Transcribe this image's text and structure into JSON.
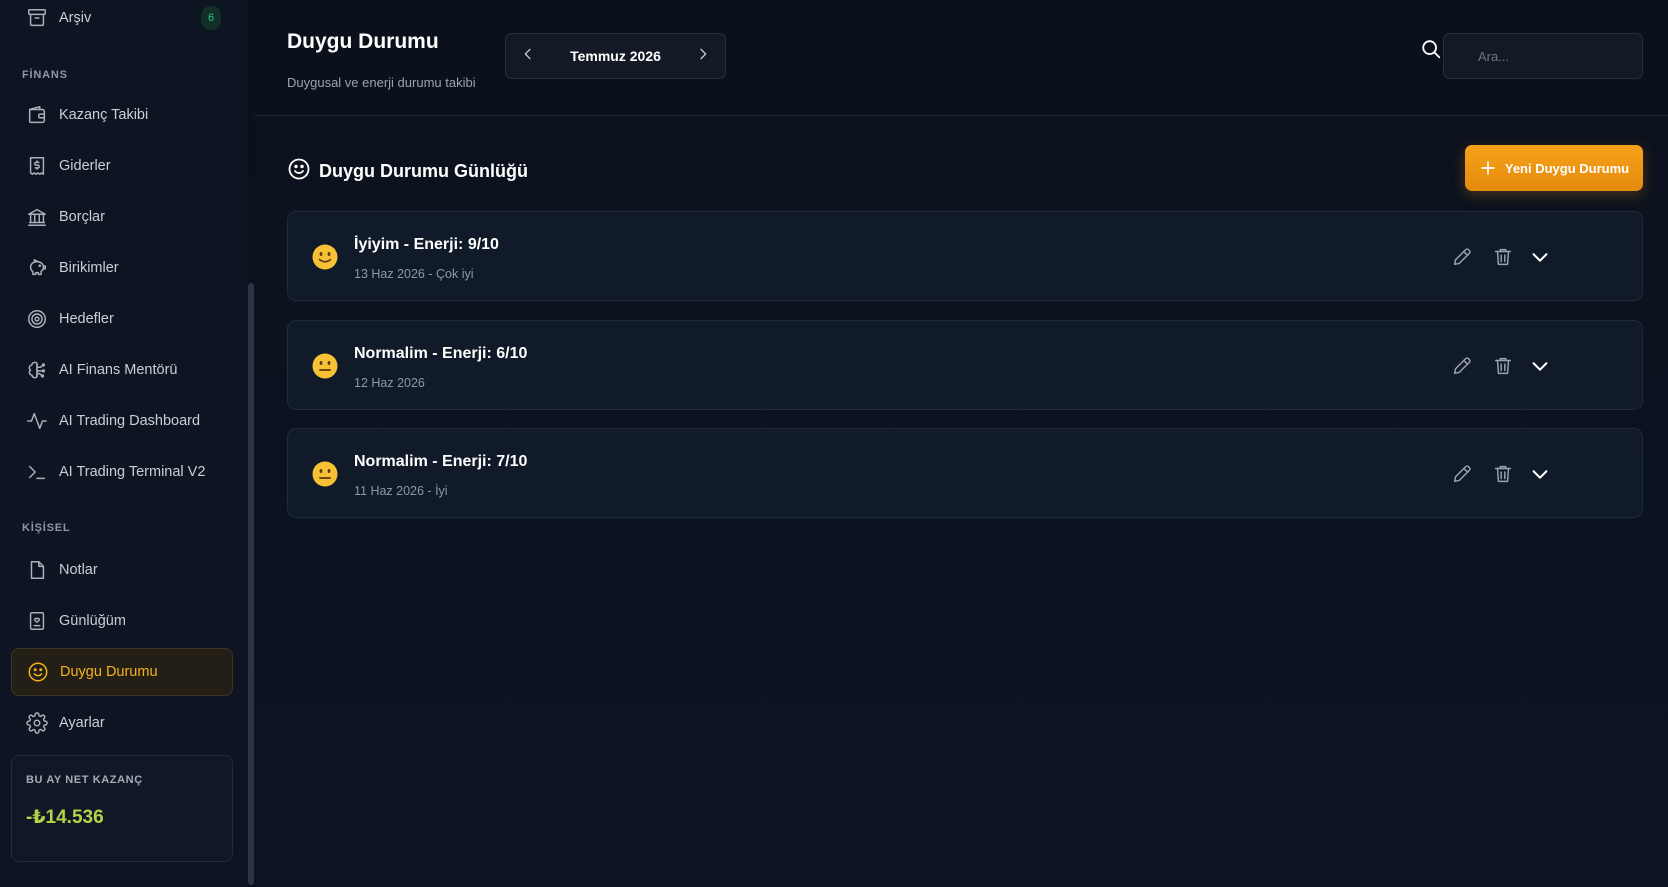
{
  "sidebar": {
    "archive": {
      "label": "Arşiv",
      "badge": "6",
      "icon": "archive-icon"
    },
    "sections": {
      "finance": "FİNANS",
      "personal": "KİŞİSEL"
    },
    "items": [
      {
        "label": "Kazanç Takibi",
        "icon": "wallet-icon"
      },
      {
        "label": "Giderler",
        "icon": "receipt-icon"
      },
      {
        "label": "Borçlar",
        "icon": "bank-icon"
      },
      {
        "label": "Birikimler",
        "icon": "piggy-bank-icon"
      },
      {
        "label": "Hedefler",
        "icon": "target-icon"
      },
      {
        "label": "AI Finans Mentörü",
        "icon": "brain-icon"
      },
      {
        "label": "AI Trading Dashboard",
        "icon": "activity-icon"
      },
      {
        "label": "AI Trading Terminal V2",
        "icon": "terminal-icon"
      },
      {
        "label": "Notlar",
        "icon": "file-icon"
      },
      {
        "label": "Günlüğüm",
        "icon": "journal-icon"
      },
      {
        "label": "Duygu Durumu",
        "icon": "smile-icon",
        "active": true
      },
      {
        "label": "Ayarlar",
        "icon": "gear-icon"
      }
    ],
    "net_card": {
      "label": "BU AY NET KAZANÇ",
      "value": "-₺14.536",
      "color": "#b7d14a"
    }
  },
  "header": {
    "title": "Duygu Durumu",
    "subtitle": "Duygusal ve enerji durumu takibi",
    "month": "Temmuz 2026",
    "search_placeholder": "Ara..."
  },
  "main": {
    "section_title": "Duygu Durumu Günlüğü",
    "new_button": "Yeni Duygu Durumu",
    "entries": [
      {
        "title": "İyiyim - Enerji: 9/10",
        "subtitle": "13 Haz 2026 - Çok iyi",
        "mood": "slight-smile"
      },
      {
        "title": "Normalim - Enerji: 6/10",
        "subtitle": "12 Haz 2026",
        "mood": "neutral"
      },
      {
        "title": "Normalim - Enerji: 7/10",
        "subtitle": "11 Haz 2026 - İyi",
        "mood": "neutral"
      }
    ]
  },
  "colors": {
    "accent": "#f5b21b",
    "button": "#f39a16",
    "background": "#0b1220"
  }
}
